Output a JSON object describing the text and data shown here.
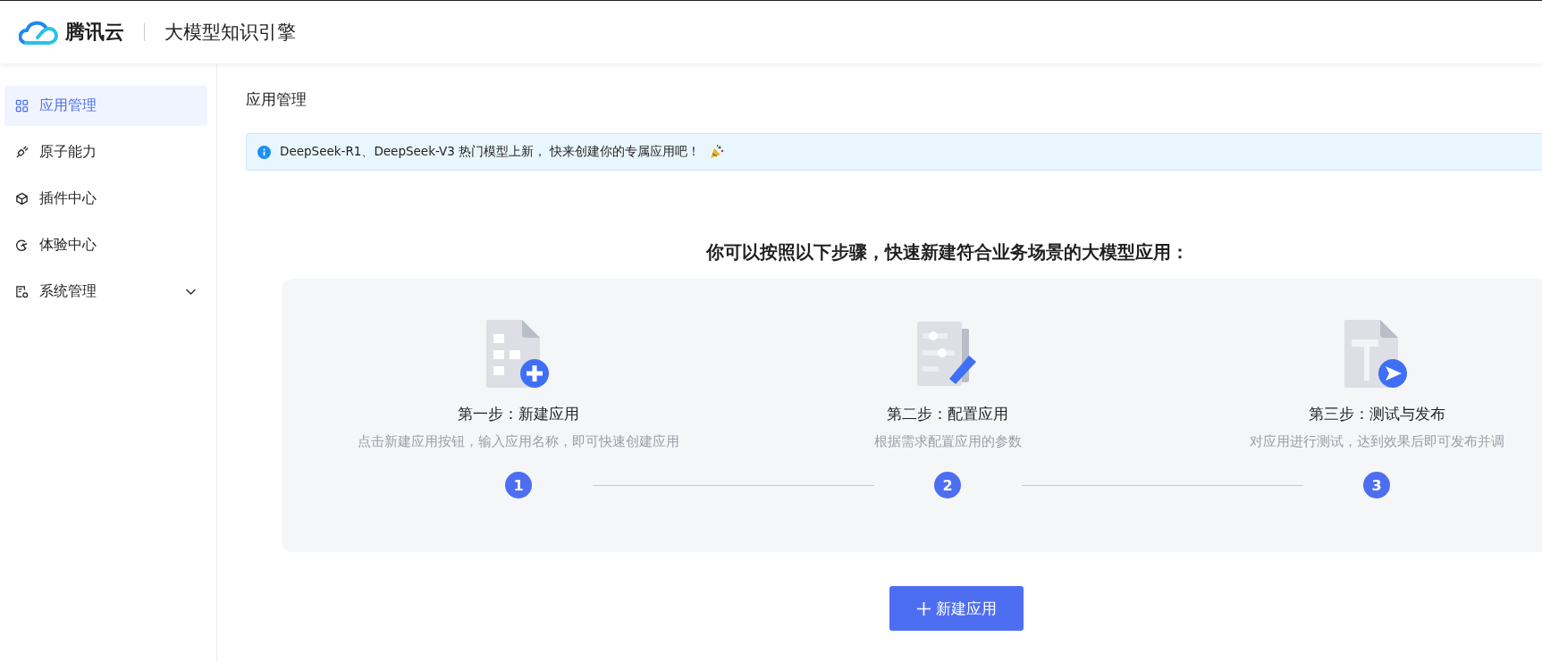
{
  "header": {
    "brand": "腾讯云",
    "product": "大模型知识引擎"
  },
  "sidebar": {
    "items": [
      {
        "label": "应用管理",
        "selected": true
      },
      {
        "label": "原子能力",
        "selected": false
      },
      {
        "label": "插件中心",
        "selected": false
      },
      {
        "label": "体验中心",
        "selected": false
      },
      {
        "label": "系统管理",
        "selected": false,
        "expanded": false
      }
    ]
  },
  "page_title": "应用管理",
  "notice": {
    "text": "DeepSeek-R1、DeepSeek-V3 热门模型上新， 快来创建你的专属应用吧！"
  },
  "headline": "你可以按照以下步骤，快速新建符合业务场景的大模型应用：",
  "steps": [
    {
      "title": "第一步：新建应用",
      "description": "点击新建应用按钮，输入应用名称，即可快速创建应用",
      "number": "1"
    },
    {
      "title": "第二步：配置应用",
      "description": "根据需求配置应用的参数",
      "number": "2"
    },
    {
      "title": "第三步：测试与发布",
      "description": "对应用进行测试，达到效果后即可发布并调",
      "number": "3"
    }
  ],
  "create_button": {
    "label": "新建应用"
  }
}
